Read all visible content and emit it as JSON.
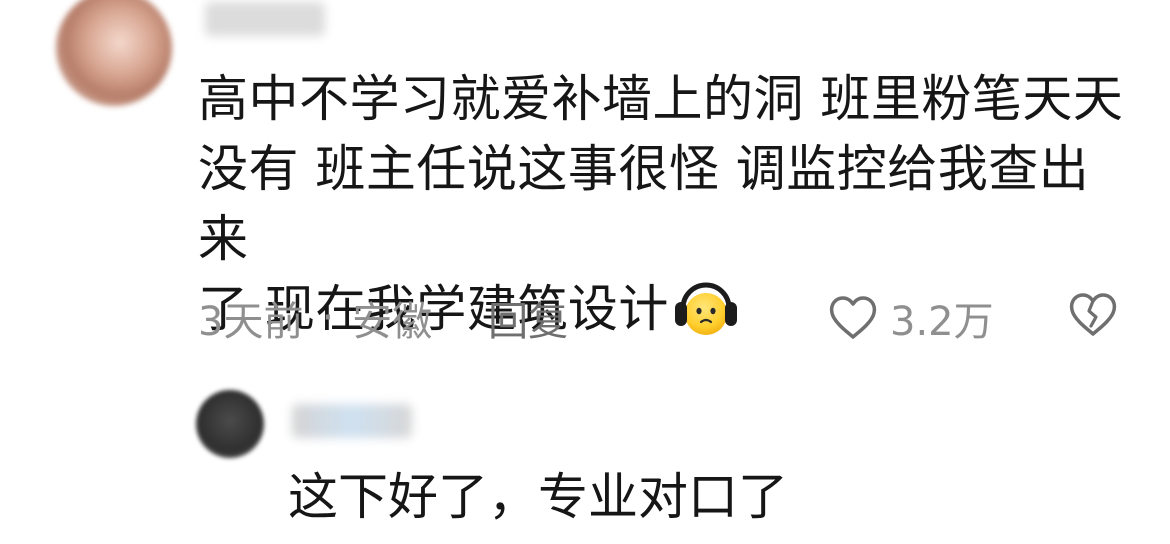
{
  "comment": {
    "lines": [
      "高中不学习就爱补墙上的洞 班里粉笔天天",
      "没有 班主任说这事很怪 调监控给我查出来",
      "了 现在我学建筑设计"
    ],
    "emoji": "headphones-face-emoji",
    "time": "3天前",
    "separator": "·",
    "location": "安徽",
    "reply_label": "回复",
    "like_count": "3.2万"
  },
  "reply": {
    "text": "这下好了，专业对口了"
  }
}
